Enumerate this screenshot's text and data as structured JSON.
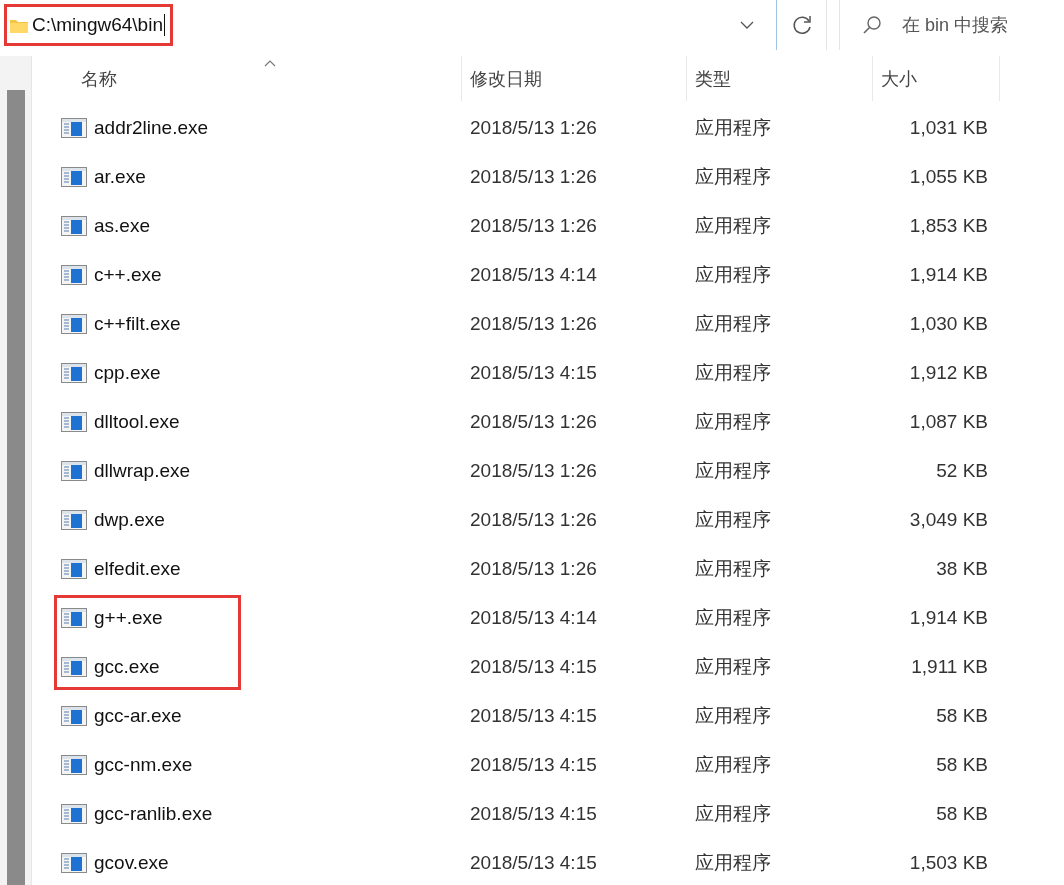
{
  "address_bar": {
    "path": "C:\\mingw64\\bin",
    "highlighted": true
  },
  "search": {
    "placeholder": "在 bin 中搜索"
  },
  "columns": [
    {
      "label": "名称",
      "sorted": true
    },
    {
      "label": "修改日期",
      "sorted": false
    },
    {
      "label": "类型",
      "sorted": false
    },
    {
      "label": "大小",
      "sorted": false
    }
  ],
  "rows": [
    {
      "name": "addr2line.exe",
      "modified": "2018/5/13 1:26",
      "type": "应用程序",
      "size": "1,031 KB",
      "highlighted": false
    },
    {
      "name": "ar.exe",
      "modified": "2018/5/13 1:26",
      "type": "应用程序",
      "size": "1,055 KB",
      "highlighted": false
    },
    {
      "name": "as.exe",
      "modified": "2018/5/13 1:26",
      "type": "应用程序",
      "size": "1,853 KB",
      "highlighted": false
    },
    {
      "name": "c++.exe",
      "modified": "2018/5/13 4:14",
      "type": "应用程序",
      "size": "1,914 KB",
      "highlighted": false
    },
    {
      "name": "c++filt.exe",
      "modified": "2018/5/13 1:26",
      "type": "应用程序",
      "size": "1,030 KB",
      "highlighted": false
    },
    {
      "name": "cpp.exe",
      "modified": "2018/5/13 4:15",
      "type": "应用程序",
      "size": "1,912 KB",
      "highlighted": false
    },
    {
      "name": "dlltool.exe",
      "modified": "2018/5/13 1:26",
      "type": "应用程序",
      "size": "1,087 KB",
      "highlighted": false
    },
    {
      "name": "dllwrap.exe",
      "modified": "2018/5/13 1:26",
      "type": "应用程序",
      "size": "52 KB",
      "highlighted": false
    },
    {
      "name": "dwp.exe",
      "modified": "2018/5/13 1:26",
      "type": "应用程序",
      "size": "3,049 KB",
      "highlighted": false
    },
    {
      "name": "elfedit.exe",
      "modified": "2018/5/13 1:26",
      "type": "应用程序",
      "size": "38 KB",
      "highlighted": false
    },
    {
      "name": "g++.exe",
      "modified": "2018/5/13 4:14",
      "type": "应用程序",
      "size": "1,914 KB",
      "highlighted": true
    },
    {
      "name": "gcc.exe",
      "modified": "2018/5/13 4:15",
      "type": "应用程序",
      "size": "1,911 KB",
      "highlighted": true
    },
    {
      "name": "gcc-ar.exe",
      "modified": "2018/5/13 4:15",
      "type": "应用程序",
      "size": "58 KB",
      "highlighted": false
    },
    {
      "name": "gcc-nm.exe",
      "modified": "2018/5/13 4:15",
      "type": "应用程序",
      "size": "58 KB",
      "highlighted": false
    },
    {
      "name": "gcc-ranlib.exe",
      "modified": "2018/5/13 4:15",
      "type": "应用程序",
      "size": "58 KB",
      "highlighted": false
    },
    {
      "name": "gcov.exe",
      "modified": "2018/5/13 4:15",
      "type": "应用程序",
      "size": "1,503 KB",
      "highlighted": false
    }
  ]
}
